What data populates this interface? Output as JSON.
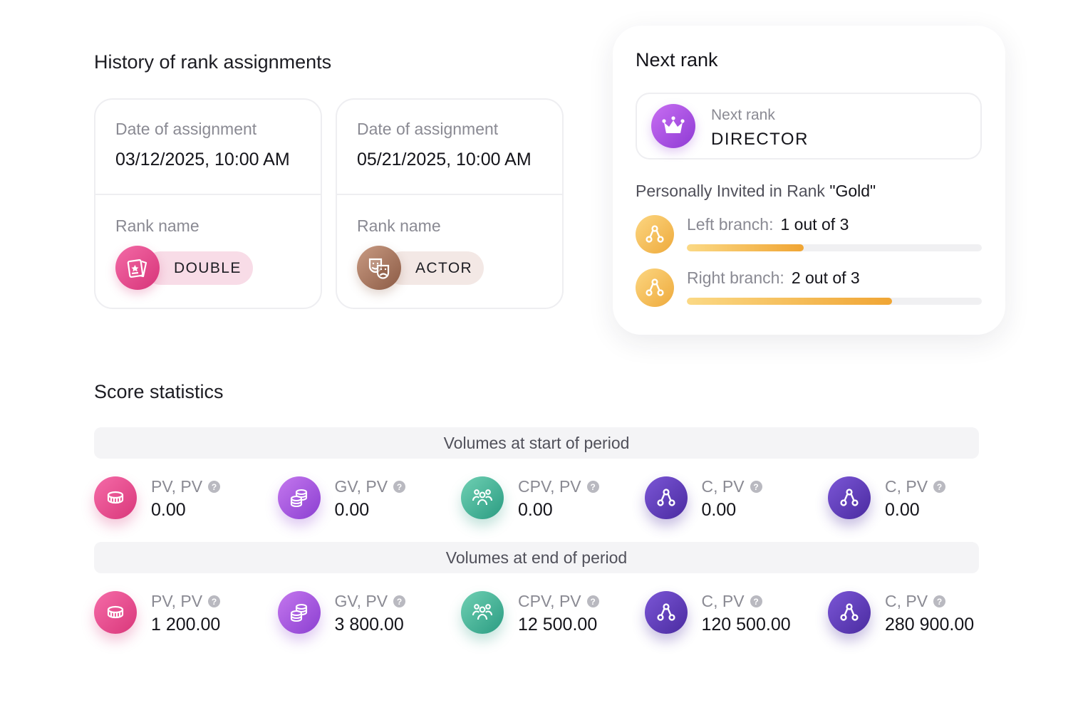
{
  "history": {
    "title": "History of rank assignments",
    "cards": [
      {
        "date_label": "Date of assignment",
        "date": "03/12/2025, 10:00 AM",
        "rank_label": "Rank name",
        "rank": "DOUBLE",
        "icon": "ticket-icon",
        "color": "#d73479"
      },
      {
        "date_label": "Date of assignment",
        "date": "05/21/2025, 10:00 AM",
        "rank_label": "Rank name",
        "rank": "ACTOR",
        "icon": "theater-masks-icon",
        "color": "#8c5b45"
      }
    ]
  },
  "next_rank": {
    "title": "Next rank",
    "label": "Next rank",
    "value": "DIRECTOR",
    "icon": "crown-icon",
    "invited_label": "Personally Invited in Rank",
    "invited_rank": "\"Gold\"",
    "branches": [
      {
        "label": "Left branch:",
        "value": "1 out of 3",
        "current": 1,
        "total": 3,
        "progress": 0.395,
        "icon": "binary-tree-icon"
      },
      {
        "label": "Right branch:",
        "value": "2 out of 3",
        "current": 2,
        "total": 3,
        "progress": 0.695,
        "icon": "binary-tree-icon"
      }
    ]
  },
  "score": {
    "title": "Score statistics",
    "periods": [
      {
        "title": "Volumes at start of period",
        "stats": [
          {
            "label": "PV, PV",
            "value": "0.00",
            "icon": "coin-icon",
            "color": "pink"
          },
          {
            "label": "GV, PV",
            "value": "0.00",
            "icon": "coin-stack-icon",
            "color": "violet"
          },
          {
            "label": "CPV, PV",
            "value": "0.00",
            "icon": "team-icon",
            "color": "teal"
          },
          {
            "label": "C, PV",
            "value": "0.00",
            "icon": "binary-tree-icon",
            "color": "indigo"
          },
          {
            "label": "C, PV",
            "value": "0.00",
            "icon": "binary-tree-icon",
            "color": "indigo"
          }
        ]
      },
      {
        "title": "Volumes at end of period",
        "stats": [
          {
            "label": "PV, PV",
            "value": "1 200.00",
            "icon": "coin-icon",
            "color": "pink"
          },
          {
            "label": "GV, PV",
            "value": "3 800.00",
            "icon": "coin-stack-icon",
            "color": "violet"
          },
          {
            "label": "CPV, PV",
            "value": "12 500.00",
            "icon": "team-icon",
            "color": "teal"
          },
          {
            "label": "C, PV",
            "value": "120 500.00",
            "icon": "binary-tree-icon",
            "color": "indigo"
          },
          {
            "label": "C, PV",
            "value": "280 900.00",
            "icon": "binary-tree-icon",
            "color": "indigo"
          }
        ]
      }
    ],
    "help_glyph": "?"
  }
}
